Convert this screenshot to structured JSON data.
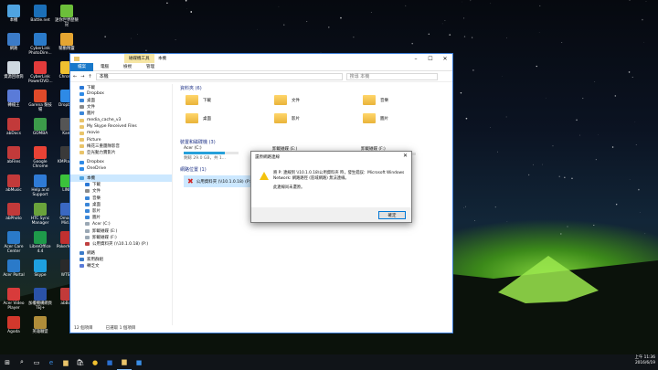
{
  "desktop_icons": [
    {
      "label": "本機",
      "color": "#4fa3e0"
    },
    {
      "label": "Battle.net",
      "color": "#1b6fb8"
    },
    {
      "label": "迷你世界歷險記",
      "color": "#6cbf3a"
    },
    {
      "label": "網路",
      "color": "#3b7bc8"
    },
    {
      "label": "CyberLink PhotoDire...",
      "color": "#2a7ac9"
    },
    {
      "label": "驅動精靈",
      "color": "#e5a531"
    },
    {
      "label": "資源回收筒",
      "color": "#cfd8e0"
    },
    {
      "label": "CyberLink PowerDVD...",
      "color": "#e23b3b"
    },
    {
      "label": "Chrome",
      "color": "#f0c030"
    },
    {
      "label": "轉檔王",
      "color": "#5a7bd8"
    },
    {
      "label": "Garena 競技場",
      "color": "#e04a2a"
    },
    {
      "label": "Dropbox",
      "color": "#2e8ae6"
    },
    {
      "label": "abDocs",
      "color": "#c23a3a"
    },
    {
      "label": "GOMBA",
      "color": "#3c9b4a"
    },
    {
      "label": "Kam",
      "color": "#555555"
    },
    {
      "label": "abFiles",
      "color": "#c23a3a"
    },
    {
      "label": "Google Chrome",
      "color": "#e94235"
    },
    {
      "label": "KMPlayer",
      "color": "#3a3a3a"
    },
    {
      "label": "abMusic",
      "color": "#c23a3a"
    },
    {
      "label": "Help and Support",
      "color": "#2f7bd6"
    },
    {
      "label": "LINE",
      "color": "#3bc23b"
    },
    {
      "label": "abPhoto",
      "color": "#c23a3a"
    },
    {
      "label": "HTC Sync Manager",
      "color": "#6aa33b"
    },
    {
      "label": "Omaxx Mid...",
      "color": "#3a68c2"
    },
    {
      "label": "Acer Care Center",
      "color": "#2a7ac9"
    },
    {
      "label": "LibreOffice 4.4",
      "color": "#1e9a4a"
    },
    {
      "label": "PokerMo...",
      "color": "#c03030"
    },
    {
      "label": "Acer Portal",
      "color": "#2a7ac9"
    },
    {
      "label": "Skype",
      "color": "#1ea0e0"
    },
    {
      "label": "WTSZ",
      "color": "#2a2a2a"
    },
    {
      "label": "Acer Video Player",
      "color": "#d83b3b"
    },
    {
      "label": "加權機構網頁TEJ+",
      "color": "#2a52a8"
    },
    {
      "label": "abBox",
      "color": "#c23a3a"
    },
    {
      "label": "Agoda",
      "color": "#d2382c"
    },
    {
      "label": "英雄聯盟",
      "color": "#b08d3a"
    }
  ],
  "window": {
    "title": "本機",
    "contextual_tab": "磁碟機工具",
    "ribbon_tabs": [
      "檔案",
      "電腦",
      "檢視",
      "管理"
    ],
    "address": "本機",
    "search_placeholder": "搜尋 本機",
    "nav_items": [
      {
        "label": "下載",
        "color": "#2a78d6"
      },
      {
        "label": "Dropbox",
        "color": "#2e8ae6"
      },
      {
        "label": "桌面",
        "color": "#3a86d8"
      },
      {
        "label": "文件",
        "color": "#8a8a8a"
      },
      {
        "label": "圖片",
        "color": "#3a86d8"
      },
      {
        "label": "media_cache_v3",
        "color": "#e9c46a"
      },
      {
        "label": "My Skype Received Files",
        "color": "#e9c46a"
      },
      {
        "label": "movie",
        "color": "#e9c46a"
      },
      {
        "label": "Picture",
        "color": "#e9c46a"
      },
      {
        "label": "梅花三重團隊影音",
        "color": "#e9c46a"
      },
      {
        "label": "亞光動力實影片",
        "color": "#e9c46a"
      },
      {
        "label": "Dropbox",
        "color": "#2e8ae6"
      },
      {
        "label": "OneDrive",
        "color": "#2e8ae6"
      },
      {
        "label": "本機",
        "color": "#4fa3e0"
      },
      {
        "label": "下載",
        "color": "#2a78d6"
      },
      {
        "label": "文件",
        "color": "#8a8a8a"
      },
      {
        "label": "音樂",
        "color": "#3a86d8"
      },
      {
        "label": "桌面",
        "color": "#3a86d8"
      },
      {
        "label": "影片",
        "color": "#3a86d8"
      },
      {
        "label": "圖片",
        "color": "#3a86d8"
      },
      {
        "label": "Acer (C:)",
        "color": "#9aa7b4"
      },
      {
        "label": "卸載磁碟 (E:)",
        "color": "#9aa7b4"
      },
      {
        "label": "卸載磁碟 (F:)",
        "color": "#9aa7b4"
      },
      {
        "label": "公用資料夾 (\\\\10.1.0.18) (P:)",
        "color": "#c04040"
      },
      {
        "label": "網路",
        "color": "#3b7bc8"
      },
      {
        "label": "家用群組",
        "color": "#3b7bc8"
      },
      {
        "label": "轉乏文",
        "color": "#5a7bd8"
      }
    ],
    "groups": {
      "folders": "資料夾 (6)",
      "drives": "裝置和磁碟機 (3)",
      "network": "網路位置 (1)"
    },
    "folders": [
      "下載",
      "文件",
      "音樂",
      "桌面",
      "影片",
      "圖片"
    ],
    "drives": [
      {
        "name": "Acer (C:)",
        "free": "剩餘 29.0 GB，共 1...",
        "fill": 0.75
      },
      {
        "name": "卸載磁碟 (E:)",
        "free": "",
        "fill": 0
      },
      {
        "name": "卸載磁碟 (F:)",
        "free": "",
        "fill": 0
      }
    ],
    "network_location": "公用資料夾 (\\\\10.1.0.18) (P:)",
    "status": [
      "12 個項目",
      "已選取 1 個項目"
    ]
  },
  "dialog": {
    "title": "還原網路連線",
    "message": "將 P: 連線到 \\\\10.1.0.18\\公用資料夾 時，發生錯誤：Microsoft Windows Network: 網路路徑 (區域網路) 無法連線。",
    "detail": "此連線尚未還原。",
    "ok": "確定",
    "close": "✕"
  },
  "taskbar": {
    "time": "上午 11:36",
    "date": "2016/6/19"
  }
}
